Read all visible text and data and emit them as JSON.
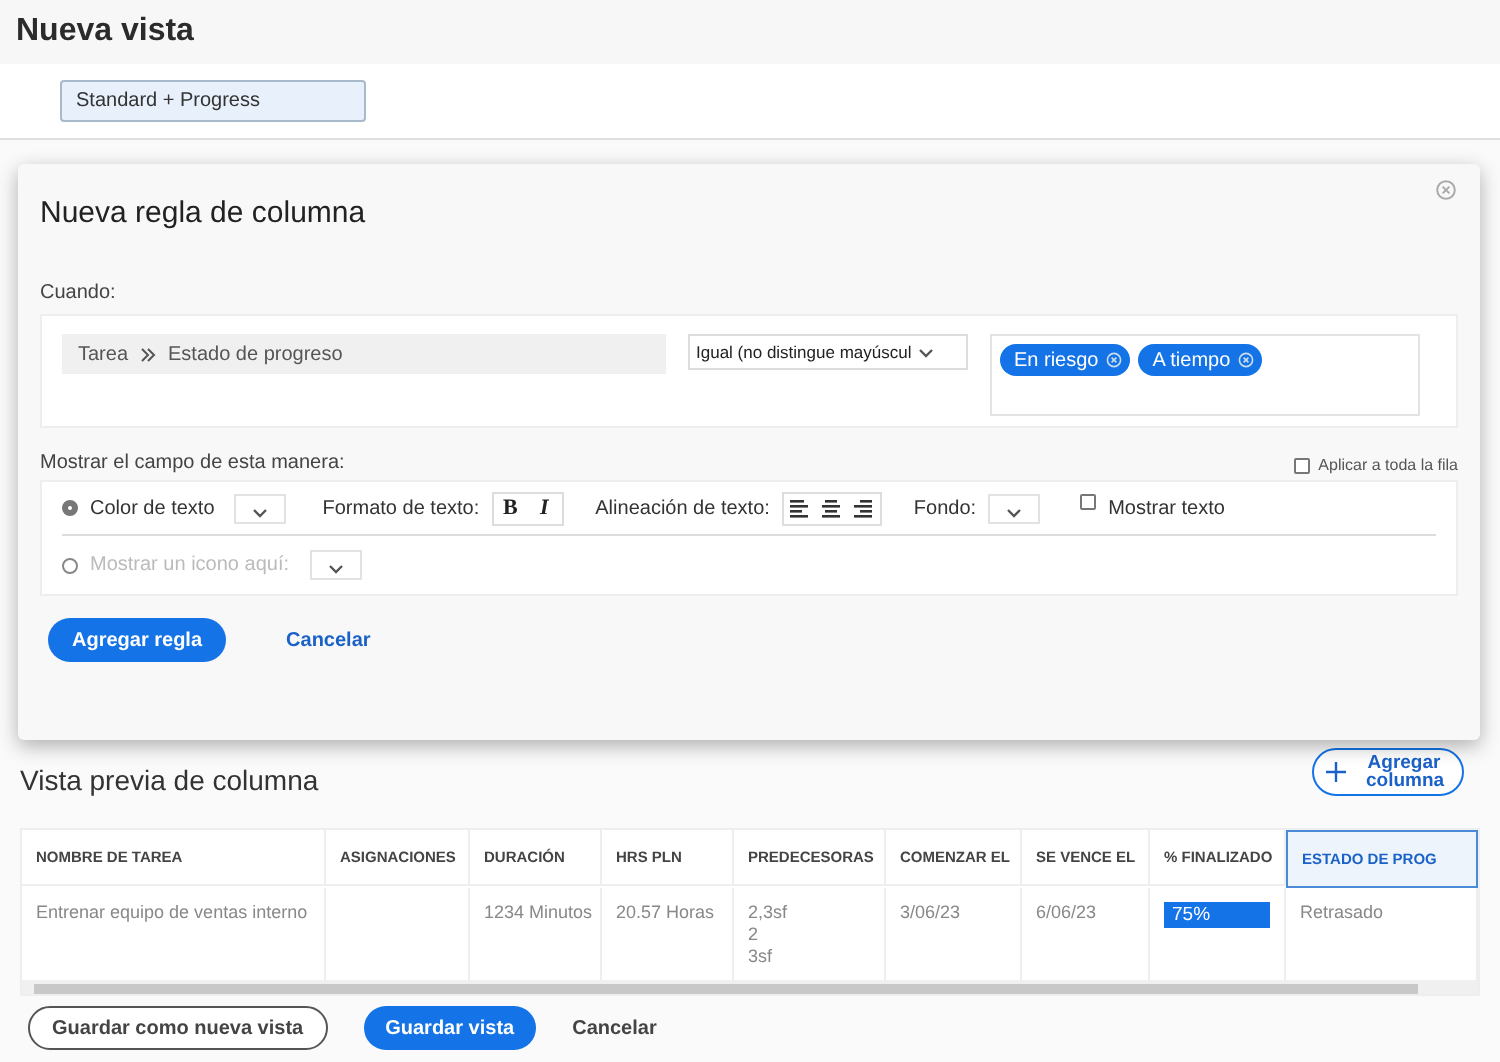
{
  "page": {
    "title": "Nueva vista",
    "view_name": "Standard + Progress"
  },
  "modal": {
    "title": "Nueva regla de columna",
    "when_label": "Cuando:",
    "field_path": [
      "Tarea",
      "Estado de progreso"
    ],
    "operator": "Igual (no distingue mayúscul",
    "values": [
      "En riesgo",
      "A tiempo"
    ],
    "display_label": "Mostrar el campo de esta manera:",
    "apply_row": {
      "label": "Aplicar a toda la fila",
      "checked": false
    },
    "options": [
      {
        "kind": "text-style",
        "label": "Color de texto",
        "selected": true,
        "disabled": false,
        "format_label": "Formato de texto:",
        "bold": "B",
        "italic": "I",
        "align_label": "Alineación de texto:",
        "background_label": "Fondo:",
        "show_text": {
          "label": "Mostrar texto",
          "checked": false
        }
      },
      {
        "kind": "icon",
        "label": "Mostrar un icono aquí:",
        "selected": false,
        "disabled": true
      }
    ],
    "primary_button": "Agregar regla",
    "cancel": "Cancelar"
  },
  "preview": {
    "title": "Vista previa de columna",
    "add_button": "Agregar columna",
    "columns": [
      {
        "label": "NOMBRE DE TAREA",
        "selected": false
      },
      {
        "label": "ASIGNACIONES",
        "selected": false
      },
      {
        "label": "DURACIÓN",
        "selected": false
      },
      {
        "label": "HRS PLN",
        "selected": false
      },
      {
        "label": "PREDECESORAS",
        "selected": false
      },
      {
        "label": "COMENZAR EL",
        "selected": false
      },
      {
        "label": "SE VENCE EL",
        "selected": false
      },
      {
        "label": "% FINALIZADO",
        "selected": false
      },
      {
        "label": "ESTADO DE PROG",
        "selected": true
      }
    ],
    "rows": [
      {
        "cells": [
          {
            "kind": "text",
            "lines": [
              "Entrenar equipo de ventas interno"
            ]
          },
          {
            "kind": "empty"
          },
          {
            "kind": "text",
            "lines": [
              "1234 Minutos"
            ]
          },
          {
            "kind": "text",
            "lines": [
              "20.57 Horas"
            ]
          },
          {
            "kind": "text",
            "lines": [
              "2,3sf",
              "2",
              "3sf"
            ]
          },
          {
            "kind": "text",
            "lines": [
              "3/06/23"
            ]
          },
          {
            "kind": "text",
            "lines": [
              "6/06/23"
            ]
          },
          {
            "kind": "percent",
            "lines": [
              "75%"
            ]
          },
          {
            "kind": "text",
            "lines": [
              "Retrasado"
            ]
          }
        ]
      }
    ]
  },
  "footer": {
    "save_as": "Guardar como nueva vista",
    "save": "Guardar vista",
    "cancel": "Cancelar"
  }
}
